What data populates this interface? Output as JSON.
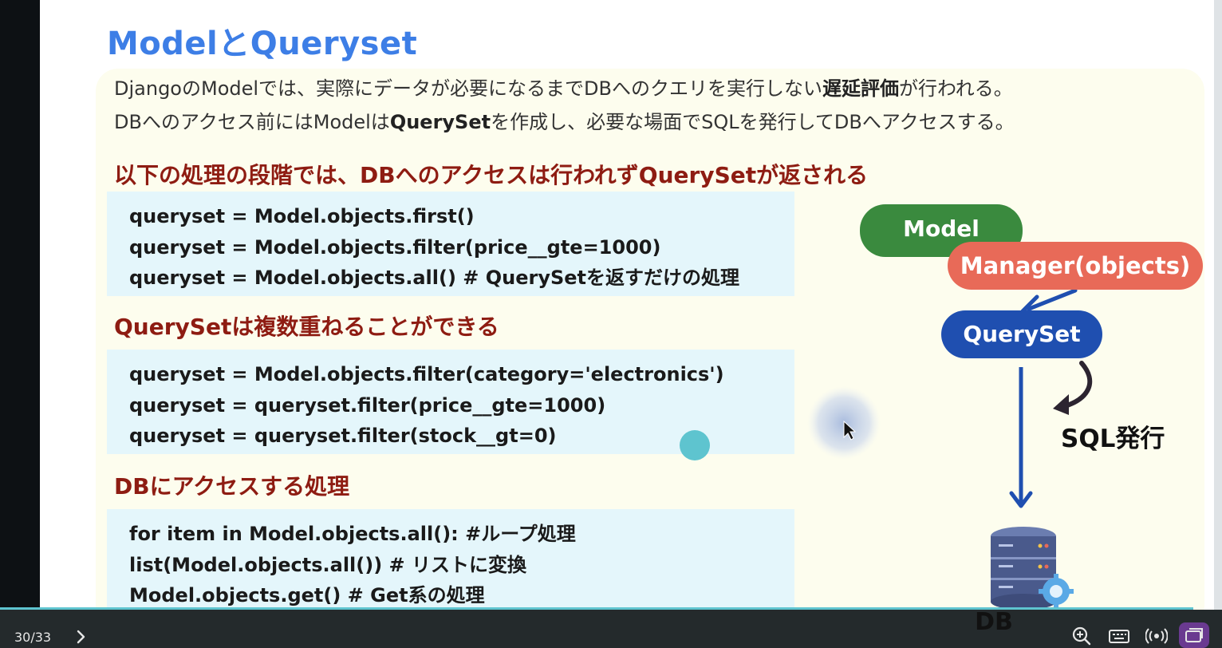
{
  "slide": {
    "title": "ModelとQueryset",
    "intro": {
      "l1_a": "DjangoのModelでは、実際にデータが必要になるまでDBへのクエリを実行しない",
      "l1_b": "遅延評価",
      "l1_c": "が行われる。",
      "l2_a": "DBへのアクセス前にはModelは",
      "l2_b": "QuerySet",
      "l2_c": "を作成し、必要な場面でSQLを発行してDBへアクセスする。"
    },
    "sections": [
      {
        "heading": "以下の処理の段階では、DBへのアクセスは行われずQuerySetが返される",
        "lines": [
          "queryset = Model.objects.first()",
          "queryset = Model.objects.filter(price__gte=1000)",
          "queryset = Model.objects.all() # QuerySetを返すだけの処理"
        ]
      },
      {
        "heading": "QuerySetは複数重ねることができる",
        "lines": [
          "queryset = Model.objects.filter(category='electronics')",
          "queryset = queryset.filter(price__gte=1000)",
          "queryset = queryset.filter(stock__gt=0)"
        ]
      },
      {
        "heading": "DBにアクセスする処理",
        "lines": [
          "for item in Model.objects.all(): #ループ処理",
          "list(Model.objects.all()) # リストに変換",
          "Model.objects.get() # Get系の処理"
        ]
      }
    ],
    "diagram": {
      "model": "Model",
      "manager": "Manager(objects)",
      "queryset": "QuerySet",
      "sql": "SQL発行",
      "db": "DB"
    }
  },
  "toolbar": {
    "page_counter": "30/33",
    "icons": [
      "chevron-right-icon",
      "zoom-in-icon",
      "keyboard-icon",
      "broadcast-icon",
      "window-icon"
    ]
  },
  "colors": {
    "title": "#3d7ee6",
    "heading": "#8e1c12",
    "code_bg": "#e4f6fb",
    "panel_bg": "#fdfdee",
    "model_pill": "#3a8a3e",
    "manager_pill": "#e86a58",
    "queryset_pill": "#1f4fb0",
    "progress": "#5ec4cf"
  }
}
